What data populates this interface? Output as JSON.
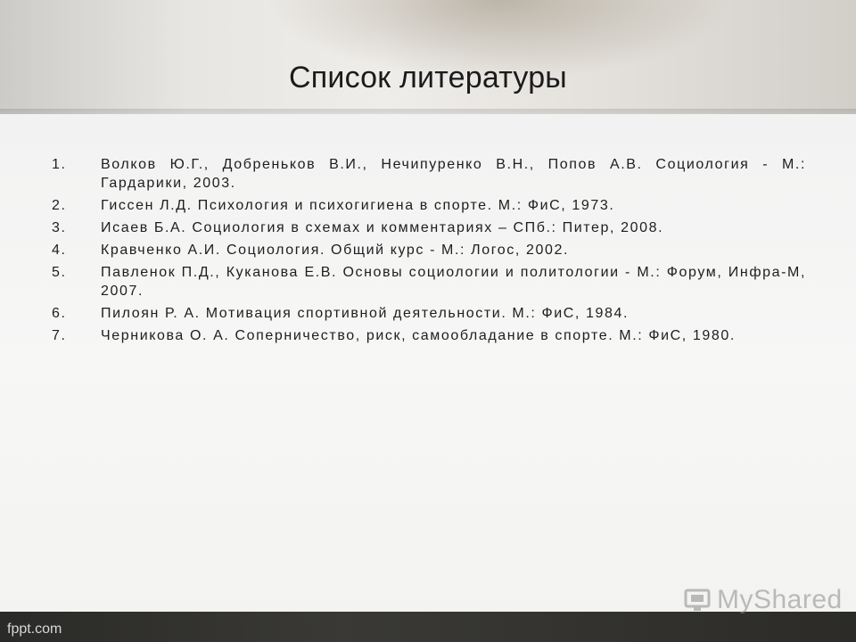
{
  "slide": {
    "title": "Список литературы",
    "references": [
      {
        "num": "1.",
        "text": "Волков Ю.Г., Добреньков В.И., Нечипуренко В.Н., Попов А.В. Социология - М.: Гардарики, 2003."
      },
      {
        "num": "2.",
        "text": "Гиссен Л.Д. Психология и психогигиена в спорте. М.: ФиС, 1973."
      },
      {
        "num": "3.",
        "text": "Исаев Б.А. Социология в схемах и комментариях – СПб.: Питер, 2008."
      },
      {
        "num": "4.",
        "text": "Кравченко А.И. Социология. Общий курс - М.: Логос, 2002."
      },
      {
        "num": "5.",
        "text": "Павленок П.Д., Куканова Е.В. Основы социологии и политологии - М.: Форум, Инфра-М, 2007."
      },
      {
        "num": "6.",
        "text": "Пилоян Р. А. Мотивация спортивной деятельности. М.: ФиС, 1984."
      },
      {
        "num": "7.",
        "text": "Черникова О. А. Соперничество, риск, самообладание в спорте. М.: ФиС, 1980."
      }
    ]
  },
  "footer": {
    "template_credit": "fppt.com"
  },
  "watermark": {
    "logo_text": "MyShared",
    "icon": "projector-logo-icon"
  }
}
